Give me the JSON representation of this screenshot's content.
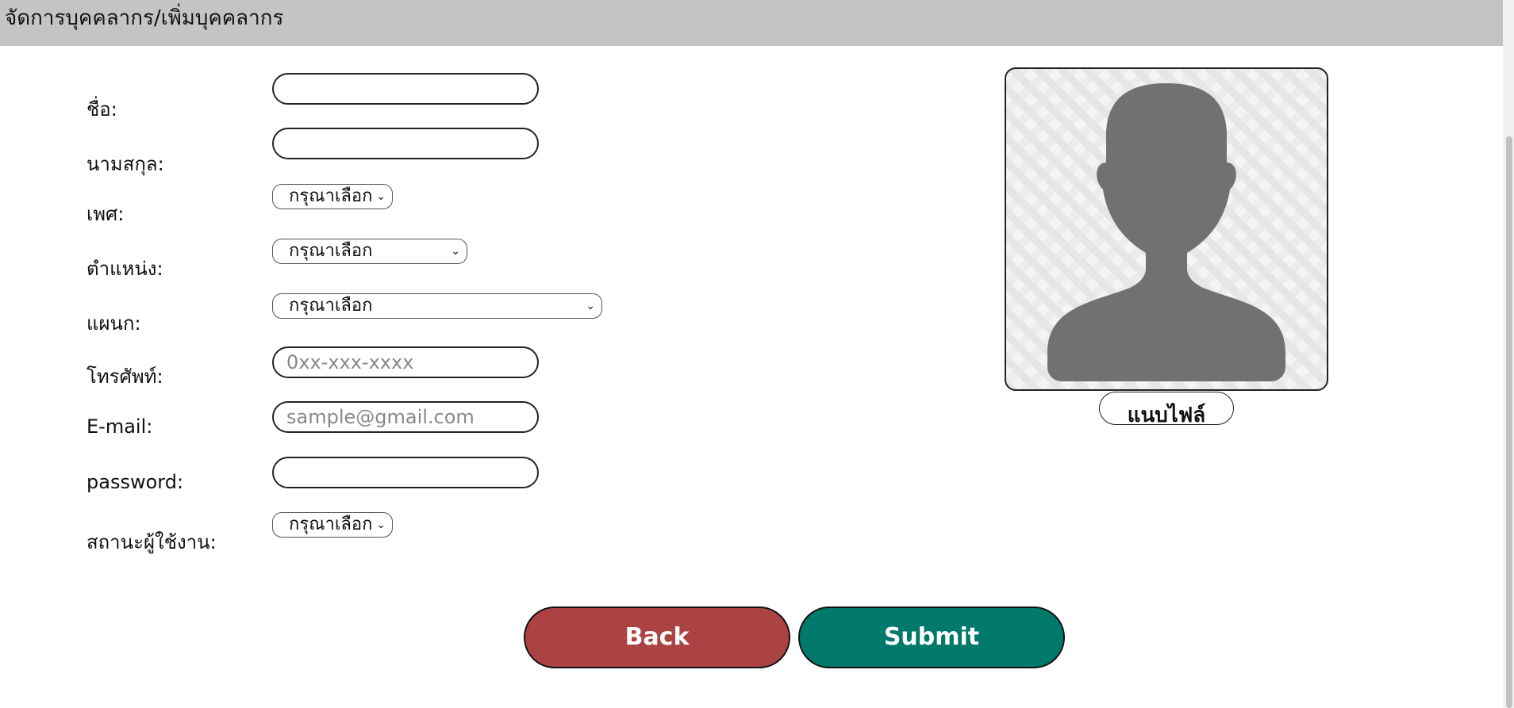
{
  "header": {
    "title": "จัดการบุคคลากร/เพิ่มบุคคลากร"
  },
  "form": {
    "first_name": {
      "label": "ชื่อ:",
      "value": ""
    },
    "last_name": {
      "label": "นามสกุล:",
      "value": ""
    },
    "gender": {
      "label": "เพศ:",
      "selected": "กรุณาเลือก"
    },
    "position": {
      "label": "ตำแหน่ง:",
      "selected": "กรุณาเลือก"
    },
    "department": {
      "label": "แผนก:",
      "selected": "กรุณาเลือก"
    },
    "phone": {
      "label": "โทรศัพท์:",
      "placeholder": "0xx-xxx-xxxx",
      "value": ""
    },
    "email": {
      "label": "E-mail:",
      "placeholder": "sample@gmail.com",
      "value": ""
    },
    "password": {
      "label": "password:",
      "value": ""
    },
    "user_status": {
      "label": "สถานะผู้ใช้งาน:",
      "selected": "กรุณาเลือก"
    }
  },
  "photo": {
    "upload_label": "แนบไฟล์",
    "icon": "avatar-placeholder-icon"
  },
  "actions": {
    "back_label": "Back",
    "submit_label": "Submit"
  },
  "colors": {
    "header_bg": "#c4c4c4",
    "back": "#ab4343",
    "submit": "#00796b",
    "avatar": "#717171"
  }
}
